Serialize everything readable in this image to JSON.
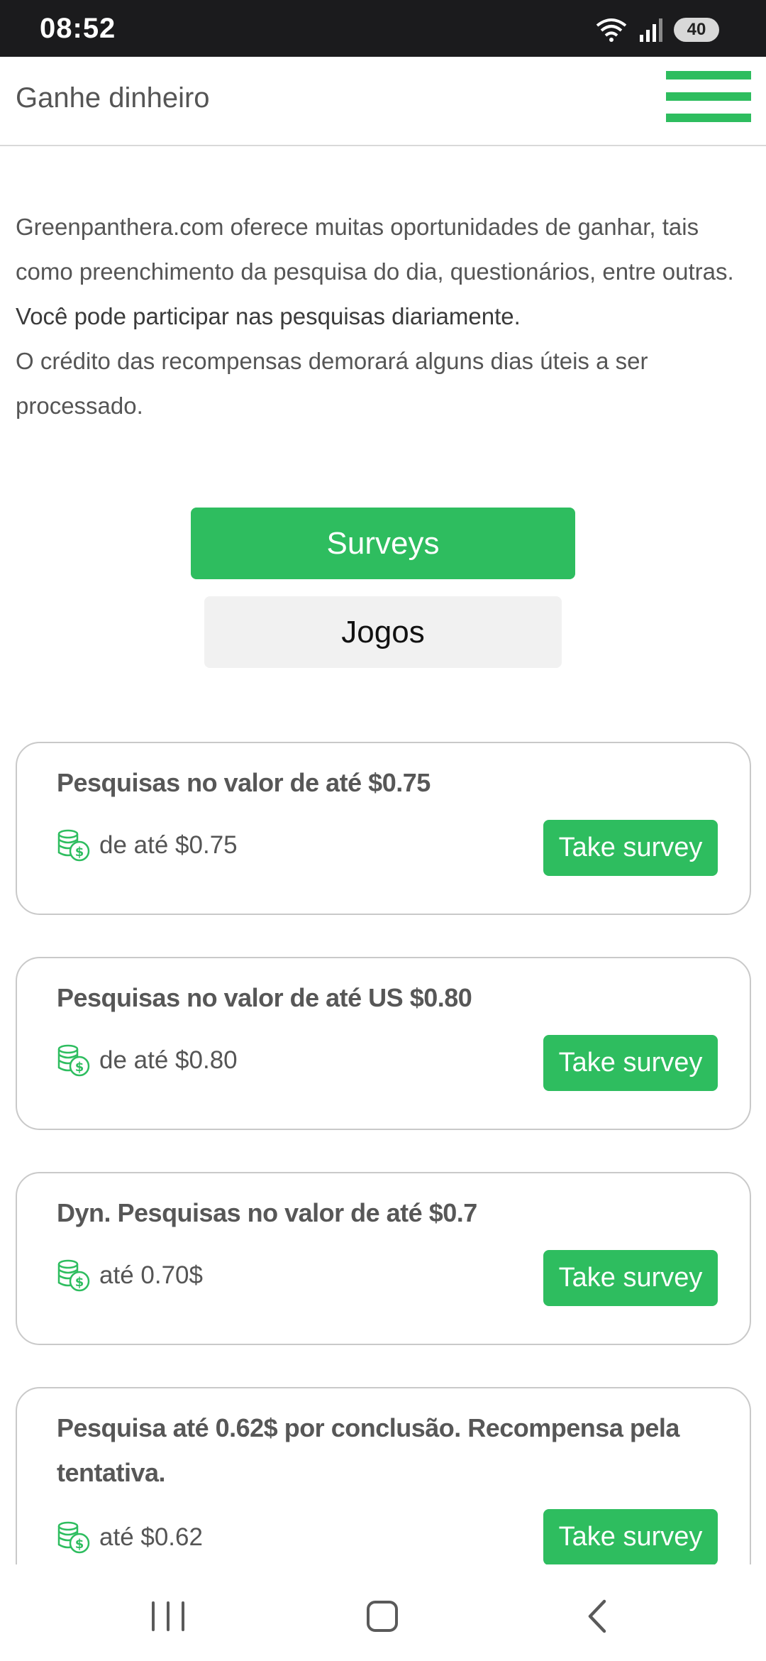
{
  "status_bar": {
    "time": "08:52",
    "battery": "40"
  },
  "app_bar": {
    "title": "Ganhe dinheiro"
  },
  "intro": {
    "paragraph_1": "Greenpanthera.com oferece muitas oportunidades de ganhar, tais como preenchimento da pesquisa do dia, questionários, entre outras.",
    "paragraph_2": "Você pode participar nas pesquisas diariamente.",
    "paragraph_3": "O crédito das recompensas demorará alguns dias úteis a ser processado."
  },
  "tabs": {
    "surveys": "Surveys",
    "jogos": "Jogos"
  },
  "surveys": [
    {
      "title": "Pesquisas no valor de até $0.75",
      "reward": "de até $0.75",
      "button": "Take survey"
    },
    {
      "title": "Pesquisas no valor de até US $0.80",
      "reward": "de até $0.80",
      "button": "Take survey"
    },
    {
      "title": "Dyn. Pesquisas no valor de até $0.7",
      "reward": "até 0.70$",
      "button": "Take survey"
    },
    {
      "title": "Pesquisa até 0.62$ por conclusão. Recompensa pela tentativa.",
      "reward": "até $0.62",
      "button": "Take survey"
    }
  ],
  "colors": {
    "accent": "#2ebd5f",
    "status_bar": "#1b1b1d",
    "tab_inactive": "#f1f1f1"
  },
  "icons": [
    "wifi-icon",
    "signal-icon",
    "battery-icon",
    "menu-icon",
    "coins-icon",
    "recents-icon",
    "home-icon",
    "back-icon"
  ]
}
